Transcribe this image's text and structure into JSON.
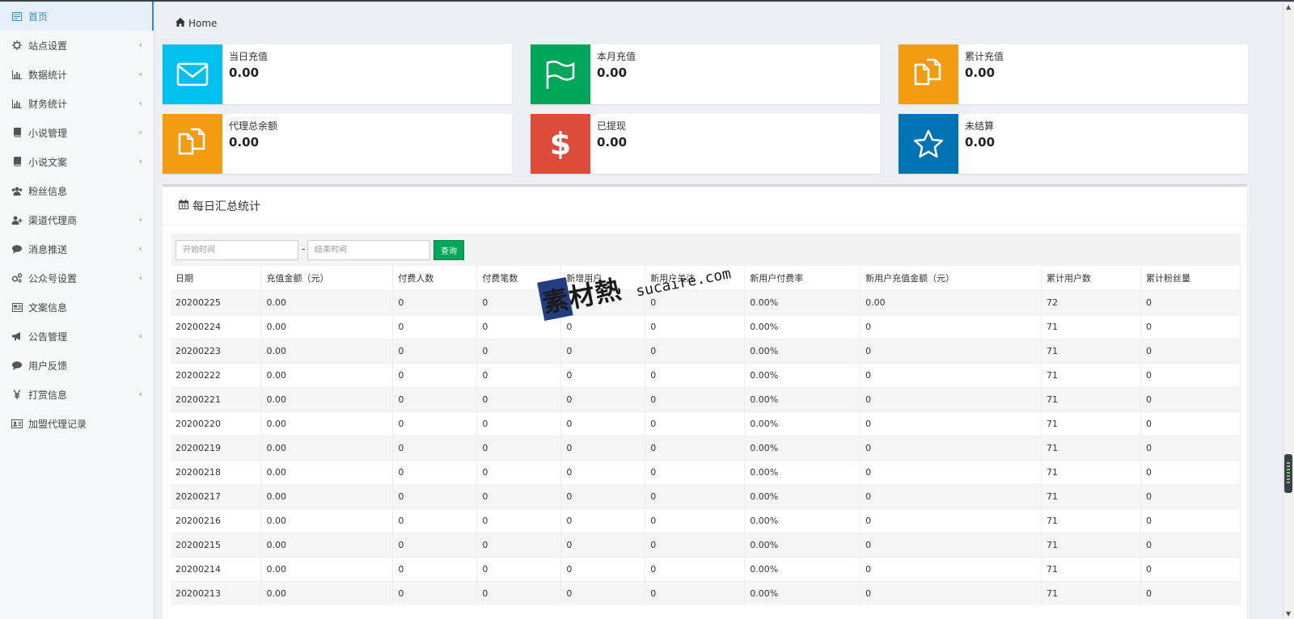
{
  "sidebar": {
    "items": [
      {
        "label": "首页",
        "icon": "dashboard-icon",
        "caret": false,
        "active": true
      },
      {
        "label": "站点设置",
        "icon": "gear-icon",
        "caret": true
      },
      {
        "label": "数据统计",
        "icon": "bar-chart-icon",
        "caret": true
      },
      {
        "label": "财务统计",
        "icon": "bar-chart-icon",
        "caret": true
      },
      {
        "label": "小说管理",
        "icon": "book-icon",
        "caret": true
      },
      {
        "label": "小说文案",
        "icon": "book-icon",
        "caret": true
      },
      {
        "label": "粉丝信息",
        "icon": "users-icon",
        "caret": false
      },
      {
        "label": "渠道代理商",
        "icon": "user-plus-icon",
        "caret": true
      },
      {
        "label": "消息推送",
        "icon": "comment-icon",
        "caret": true
      },
      {
        "label": "公众号设置",
        "icon": "gears-icon",
        "caret": true
      },
      {
        "label": "文案信息",
        "icon": "newspaper-icon",
        "caret": false
      },
      {
        "label": "公告管理",
        "icon": "bullhorn-icon",
        "caret": true
      },
      {
        "label": "用户反馈",
        "icon": "comment-icon",
        "caret": false
      },
      {
        "label": "打赏信息",
        "icon": "yen-icon",
        "caret": true
      },
      {
        "label": "加盟代理记录",
        "icon": "id-card-icon",
        "caret": false
      }
    ]
  },
  "breadcrumb": {
    "label": "Home"
  },
  "stats": [
    {
      "label": "当日充值",
      "value": "0.00",
      "color": "#00c0ef",
      "icon": "envelope-icon"
    },
    {
      "label": "本月充值",
      "value": "0.00",
      "color": "#00a65a",
      "icon": "flag-icon"
    },
    {
      "label": "累计充值",
      "value": "0.00",
      "color": "#f39c12",
      "icon": "copy-icon"
    },
    {
      "label": "代理总余额",
      "value": "0.00",
      "color": "#f39c12",
      "icon": "copy-icon"
    },
    {
      "label": "已提现",
      "value": "0.00",
      "color": "#dd4b39",
      "icon": "dollar-icon"
    },
    {
      "label": "未结算",
      "value": "0.00",
      "color": "#0073b7",
      "icon": "star-icon"
    }
  ],
  "panel": {
    "title": "每日汇总统计",
    "start_placeholder": "开始时间",
    "end_placeholder": "结束时间",
    "query_label": "查询",
    "dash": "-"
  },
  "table": {
    "headers": [
      "日期",
      "充值金额（元）",
      "付费人数",
      "付费笔数",
      "新增用户",
      "新用户关注",
      "新用户付费率",
      "新用户充值金额（元）",
      "累计用户数",
      "累计粉丝量"
    ],
    "rows": [
      [
        "20200225",
        "0.00",
        "0",
        "0",
        "0",
        "0",
        "0.00%",
        "0.00",
        "72",
        "0"
      ],
      [
        "20200224",
        "0.00",
        "0",
        "0",
        "0",
        "0",
        "0.00%",
        "0",
        "71",
        "0"
      ],
      [
        "20200223",
        "0.00",
        "0",
        "0",
        "0",
        "0",
        "0.00%",
        "0",
        "71",
        "0"
      ],
      [
        "20200222",
        "0.00",
        "0",
        "0",
        "0",
        "0",
        "0.00%",
        "0",
        "71",
        "0"
      ],
      [
        "20200221",
        "0.00",
        "0",
        "0",
        "0",
        "0",
        "0.00%",
        "0",
        "71",
        "0"
      ],
      [
        "20200220",
        "0.00",
        "0",
        "0",
        "0",
        "0",
        "0.00%",
        "0",
        "71",
        "0"
      ],
      [
        "20200219",
        "0.00",
        "0",
        "0",
        "0",
        "0",
        "0.00%",
        "0",
        "71",
        "0"
      ],
      [
        "20200218",
        "0.00",
        "0",
        "0",
        "0",
        "0",
        "0.00%",
        "0",
        "71",
        "0"
      ],
      [
        "20200217",
        "0.00",
        "0",
        "0",
        "0",
        "0",
        "0.00%",
        "0",
        "71",
        "0"
      ],
      [
        "20200216",
        "0.00",
        "0",
        "0",
        "0",
        "0",
        "0.00%",
        "0",
        "71",
        "0"
      ],
      [
        "20200215",
        "0.00",
        "0",
        "0",
        "0",
        "0",
        "0.00%",
        "0",
        "71",
        "0"
      ],
      [
        "20200214",
        "0.00",
        "0",
        "0",
        "0",
        "0",
        "0.00%",
        "0",
        "71",
        "0"
      ],
      [
        "20200213",
        "0.00",
        "0",
        "0",
        "0",
        "0",
        "0.00%",
        "0",
        "71",
        "0"
      ]
    ]
  },
  "watermark": {
    "cn": "素材熱",
    "en": "sucaire.com"
  }
}
